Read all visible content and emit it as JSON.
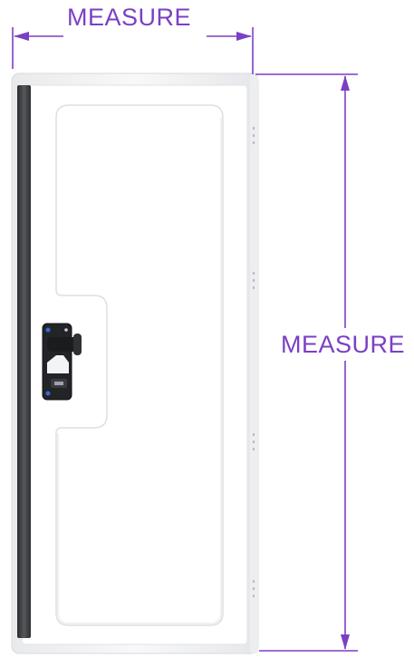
{
  "dimensions": {
    "width_label": "MEASURE",
    "height_label": "MEASURE",
    "line_color": "#7b3fc4"
  },
  "door": {
    "panel_color": "#ffffff",
    "frame_color": "#f2f3f4",
    "hinge_strip_color": "#3a3b3e",
    "latch_color": "#222326"
  }
}
